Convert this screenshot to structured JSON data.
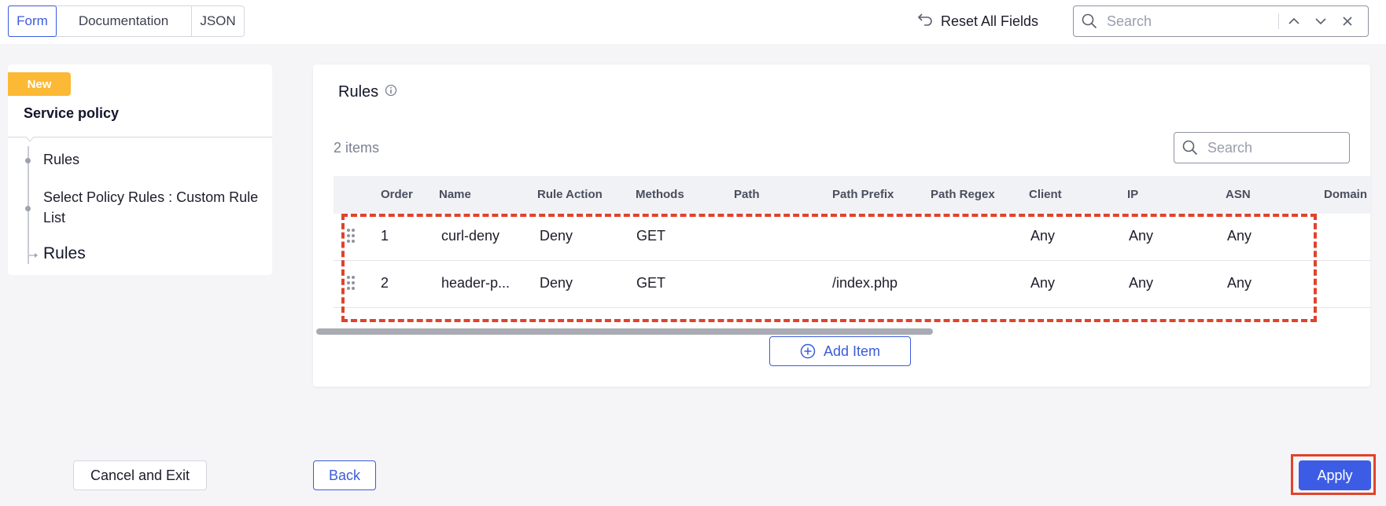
{
  "tabs": [
    {
      "label": "Form",
      "active": true
    },
    {
      "label": "Documentation",
      "active": false
    },
    {
      "label": "JSON",
      "active": false
    }
  ],
  "toolbar": {
    "reset_label": "Reset All Fields",
    "search_placeholder": "Search"
  },
  "sidebar": {
    "badge": "New",
    "title": "Service policy",
    "items": [
      {
        "label": "Rules"
      },
      {
        "label": "Select Policy Rules : Custom Rule List"
      },
      {
        "label": "Rules",
        "current": true
      }
    ]
  },
  "main": {
    "section_title": "Rules",
    "items_count": "2 items",
    "search_placeholder": "Search",
    "columns": [
      "Order",
      "Name",
      "Rule Action",
      "Methods",
      "Path",
      "Path Prefix",
      "Path Regex",
      "Client",
      "IP",
      "ASN",
      "Domain"
    ],
    "rows": [
      {
        "order": "1",
        "name": "curl-deny",
        "action": "Deny",
        "methods": "GET",
        "path": "",
        "path_prefix": "",
        "path_regex": "",
        "client": "Any",
        "ip": "Any",
        "asn": "Any",
        "domain": ""
      },
      {
        "order": "2",
        "name": "header-p...",
        "action": "Deny",
        "methods": "GET",
        "path": "",
        "path_prefix": "/index.php",
        "path_regex": "",
        "client": "Any",
        "ip": "Any",
        "asn": "Any",
        "domain": ""
      }
    ],
    "add_item_label": "Add Item"
  },
  "footer": {
    "cancel_label": "Cancel and Exit",
    "back_label": "Back",
    "apply_label": "Apply"
  },
  "colors": {
    "accent": "#3b5bdb",
    "highlight": "#e0432c",
    "badge": "#fcb935"
  }
}
